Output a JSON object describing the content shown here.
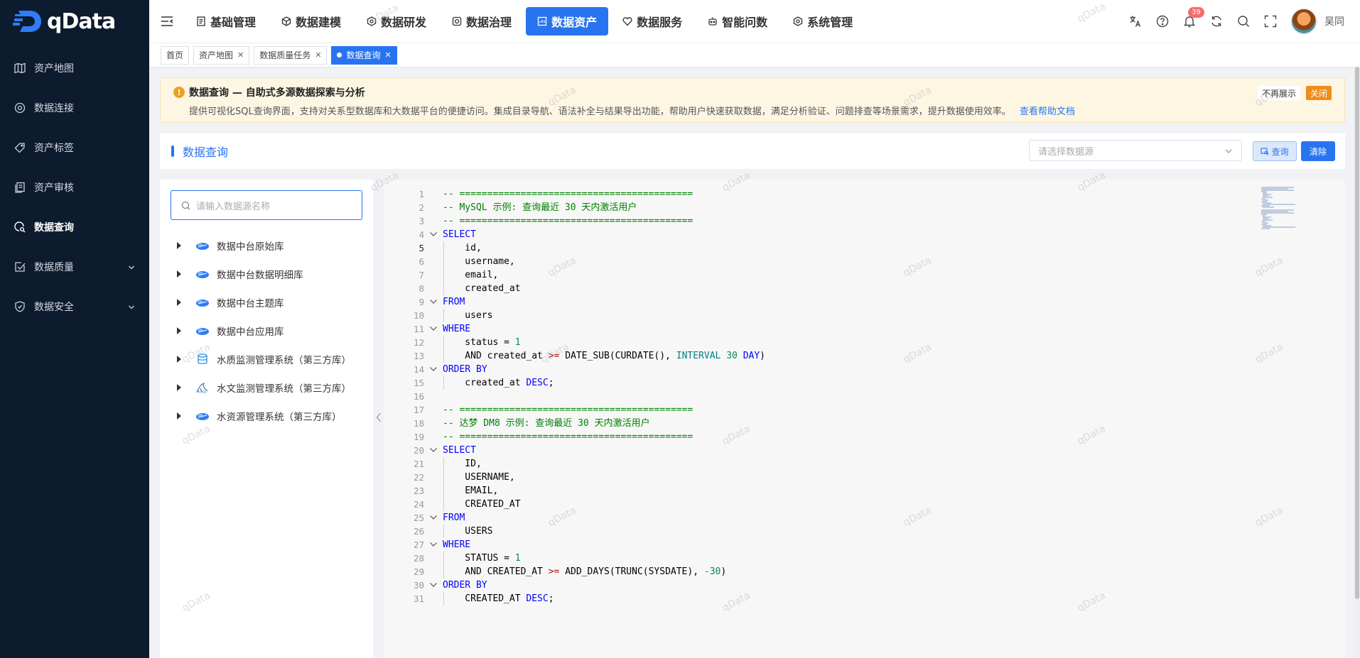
{
  "brand": {
    "name": "qData"
  },
  "sidebar": {
    "items": [
      {
        "label": "资产地图",
        "icon": "map-icon",
        "active": false,
        "expandable": false
      },
      {
        "label": "数据连接",
        "icon": "connection-icon",
        "active": false,
        "expandable": false
      },
      {
        "label": "资产标签",
        "icon": "tag-icon",
        "active": false,
        "expandable": false
      },
      {
        "label": "资产审核",
        "icon": "audit-icon",
        "active": false,
        "expandable": false
      },
      {
        "label": "数据查询",
        "icon": "query-icon",
        "active": true,
        "expandable": false
      },
      {
        "label": "数据质量",
        "icon": "quality-icon",
        "active": false,
        "expandable": true
      },
      {
        "label": "数据安全",
        "icon": "security-icon",
        "active": false,
        "expandable": true
      }
    ]
  },
  "topnav": {
    "items": [
      {
        "label": "基础管理",
        "icon": "doc-icon",
        "active": false
      },
      {
        "label": "数据建模",
        "icon": "cube-icon",
        "active": false
      },
      {
        "label": "数据研发",
        "icon": "hex-icon",
        "active": false
      },
      {
        "label": "数据治理",
        "icon": "govern-icon",
        "active": false
      },
      {
        "label": "数据资产",
        "icon": "asset-icon",
        "active": true
      },
      {
        "label": "数据服务",
        "icon": "service-icon",
        "active": false
      },
      {
        "label": "智能问数",
        "icon": "robot-icon",
        "active": false
      },
      {
        "label": "系统管理",
        "icon": "settings-icon",
        "active": false
      }
    ],
    "notifications": "39",
    "username": "吴同"
  },
  "tabs": [
    {
      "label": "首页",
      "closable": false,
      "active": false
    },
    {
      "label": "资产地图",
      "closable": true,
      "active": false
    },
    {
      "label": "数据质量任务",
      "closable": true,
      "active": false
    },
    {
      "label": "数据查询",
      "closable": true,
      "active": true
    }
  ],
  "notice": {
    "title": "数据查询 — 自助式多源数据探索与分析",
    "description": "提供可视化SQL查询界面，支持对关系型数据库和大数据平台的便捷访问。集成目录导航、语法补全与结果导出功能，帮助用户快速获取数据，满足分析验证、问题排查等场景需求，提升数据使用效率。",
    "link": "查看帮助文档",
    "dismiss_label": "不再展示",
    "close_label": "关闭"
  },
  "query": {
    "title": "数据查询",
    "datasource_placeholder": "请选择数据源",
    "query_label": "查询",
    "clear_label": "清除"
  },
  "tree": {
    "search_placeholder": "请输入数据源名称",
    "items": [
      {
        "label": "数据中台原始库",
        "icon": "cloud-db-icon"
      },
      {
        "label": "数据中台数据明细库",
        "icon": "cloud-db-icon"
      },
      {
        "label": "数据中台主题库",
        "icon": "cloud-db-icon"
      },
      {
        "label": "数据中台应用库",
        "icon": "cloud-db-icon"
      },
      {
        "label": "水质监测管理系统（第三方库）",
        "icon": "database-icon"
      },
      {
        "label": "水文监测管理系统（第三方库）",
        "icon": "mysql-icon"
      },
      {
        "label": "水资源管理系统（第三方库）",
        "icon": "cloud-db-icon"
      }
    ]
  },
  "editor": {
    "current_line": 5,
    "lines": [
      "-- ==========================================",
      "-- MySQL 示例: 查询最近 30 天内激活用户",
      "-- ==========================================",
      "SELECT",
      "    id,",
      "    username,",
      "    email,",
      "    created_at",
      "FROM",
      "    users",
      "WHERE",
      "    status = 1",
      "    AND created_at >= DATE_SUB(CURDATE(), INTERVAL 30 DAY)",
      "ORDER BY",
      "    created_at DESC;",
      "",
      "-- ==========================================",
      "-- 达梦 DM8 示例: 查询最近 30 天内激活用户",
      "-- ==========================================",
      "SELECT",
      "    ID,",
      "    USERNAME,",
      "    EMAIL,",
      "    CREATED_AT",
      "FROM",
      "    USERS",
      "WHERE",
      "    STATUS = 1",
      "    AND CREATED_AT >= ADD_DAYS(TRUNC(SYSDATE), -30)",
      "ORDER BY",
      "    CREATED_AT DESC;"
    ],
    "fold_lines": [
      4,
      9,
      11,
      14,
      20,
      25,
      27,
      30
    ]
  },
  "watermark": "qData",
  "colors": {
    "primary": "#2874f0",
    "sidebar_bg": "#0d1b2e",
    "warning": "#f08c1a",
    "notice_bg": "#fdf6e3"
  }
}
